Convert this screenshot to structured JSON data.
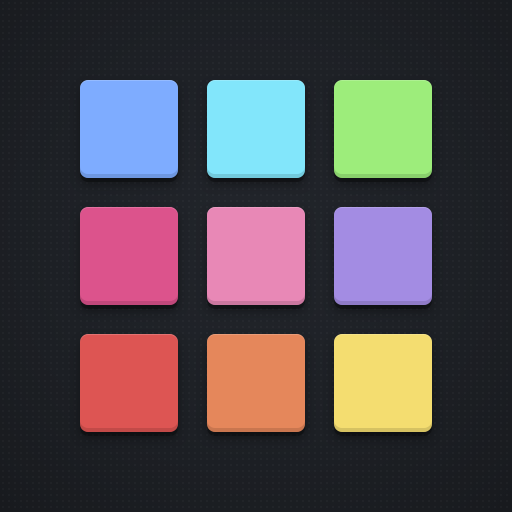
{
  "pads": [
    {
      "id": "pad-1",
      "color": "#7eacff"
    },
    {
      "id": "pad-2",
      "color": "#82e6fb"
    },
    {
      "id": "pad-3",
      "color": "#9ded7b"
    },
    {
      "id": "pad-4",
      "color": "#dc538c"
    },
    {
      "id": "pad-5",
      "color": "#e888b6"
    },
    {
      "id": "pad-6",
      "color": "#a38ce3"
    },
    {
      "id": "pad-7",
      "color": "#dd5553"
    },
    {
      "id": "pad-8",
      "color": "#e5875b"
    },
    {
      "id": "pad-9",
      "color": "#f4dd70"
    }
  ],
  "background_color": "#1d2025"
}
